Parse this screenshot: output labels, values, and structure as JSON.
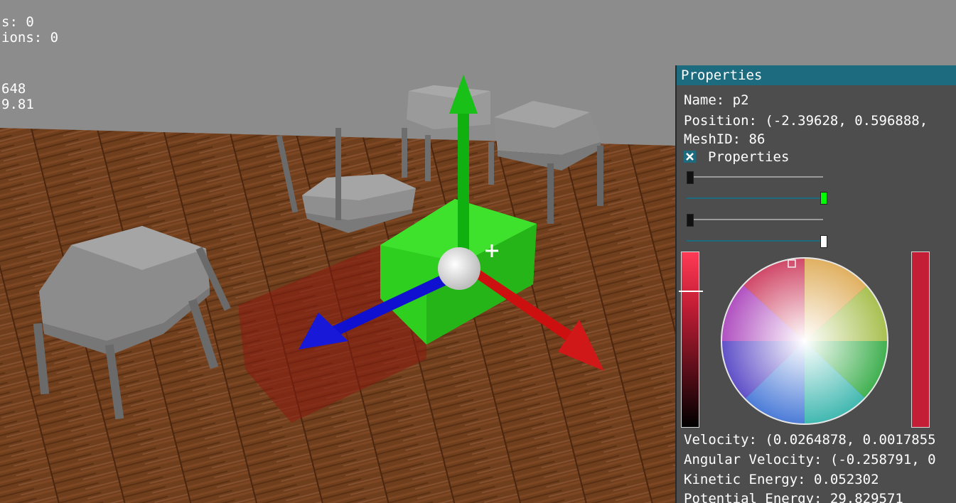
{
  "hud": {
    "line1": "s: 0",
    "line2": "ions: 0",
    "line3": "648",
    "line4": "9.81"
  },
  "properties": {
    "title": "Properties",
    "name": "Name: p2",
    "position": "Position: (-2.39628, 0.596888,",
    "mesh_id": "MeshID: 86",
    "section_label": "Properties",
    "section_checked": true,
    "sliders": [
      {
        "value": 0.0,
        "color": "#111111"
      },
      {
        "value": 1.0,
        "color": "#00ff00"
      },
      {
        "value": 0.0,
        "color": "#111111"
      },
      {
        "value": 1.0,
        "color": "#ffffff"
      }
    ],
    "color": {
      "hex": "#c41e36",
      "value_level": 0.22
    },
    "velocity": "Velocity: (0.0264878, 0.0017855",
    "angular_velocity": "Angular Velocity: (-0.258791, 0",
    "kinetic_energy": "Kinetic Energy: 0.052302",
    "potential_energy": "Potential Energy: 29.829571"
  },
  "gizmo": {
    "x_axis_color": "#cc1010",
    "y_axis_color": "#10b010",
    "z_axis_color": "#1010d0"
  }
}
